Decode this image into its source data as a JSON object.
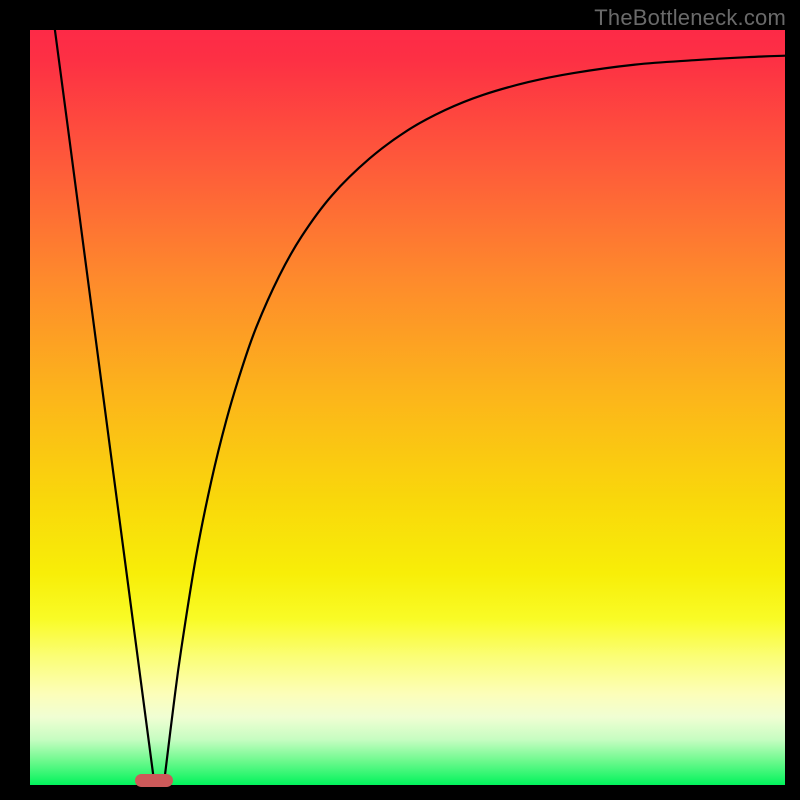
{
  "watermark": "TheBottleneck.com",
  "colors": {
    "background": "#000000",
    "curve": "#000000",
    "marker": "#cc5959"
  },
  "chart_data": {
    "type": "line",
    "title": "",
    "xlabel": "",
    "ylabel": "",
    "xlim": [
      0,
      100
    ],
    "ylim": [
      0,
      100
    ],
    "grid": false,
    "legend": false,
    "note": "Axes have no numeric tick labels or titles; x and y values are normalized 0–100 estimated from pixel positions. y=0 at bottom, y=100 at top. The two curves share a minimum near x≈16.",
    "series": [
      {
        "name": "left-line",
        "x": [
          3.3,
          5,
          7,
          9,
          11,
          13,
          14.7,
          16.3
        ],
        "y": [
          100,
          87.2,
          72,
          56.8,
          41.6,
          26.5,
          13.6,
          1.5
        ]
      },
      {
        "name": "right-curve",
        "x": [
          17.9,
          19,
          20,
          22,
          24,
          26,
          28,
          30,
          33,
          36,
          40,
          45,
          50,
          55,
          60,
          66,
          72,
          80,
          88,
          95,
          100
        ],
        "y": [
          1.5,
          10.4,
          17.8,
          30.3,
          40.2,
          48.3,
          55,
          60.7,
          67.4,
          72.7,
          78.1,
          83,
          86.7,
          89.4,
          91.4,
          93.1,
          94.3,
          95.4,
          96,
          96.4,
          96.6
        ]
      }
    ],
    "marker": {
      "shape": "rounded-rect",
      "cx": 16.4,
      "cy": 0.6,
      "width_pct": 5.1,
      "height_pct": 1.6
    },
    "background_gradient": {
      "direction": "top-to-bottom",
      "stops": [
        {
          "pct": 0,
          "color": "#fd2a47"
        },
        {
          "pct": 18,
          "color": "#fe5b3a"
        },
        {
          "pct": 33,
          "color": "#fe8a2c"
        },
        {
          "pct": 48,
          "color": "#fcb41b"
        },
        {
          "pct": 62,
          "color": "#f9d70b"
        },
        {
          "pct": 78,
          "color": "#f9fb26"
        },
        {
          "pct": 88,
          "color": "#fcfeba"
        },
        {
          "pct": 94,
          "color": "#c6fdc1"
        },
        {
          "pct": 100,
          "color": "#02f35c"
        }
      ]
    }
  }
}
